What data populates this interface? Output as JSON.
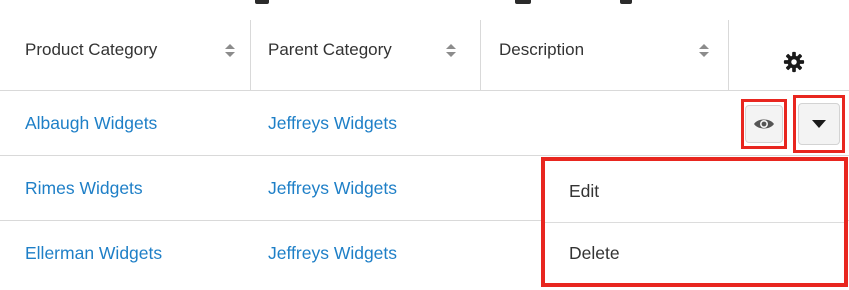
{
  "table": {
    "columns": [
      {
        "label": "Product Category"
      },
      {
        "label": "Parent Category"
      },
      {
        "label": "Description"
      }
    ],
    "rows": [
      {
        "product_category": "Albaugh Widgets",
        "parent_category": "Jeffreys Widgets",
        "description": ""
      },
      {
        "product_category": "Rimes Widgets",
        "parent_category": "Jeffreys Widgets",
        "description": ""
      },
      {
        "product_category": "Ellerman Widgets",
        "parent_category": "Jeffreys Widgets",
        "description": ""
      }
    ]
  },
  "row_actions": {
    "preview_icon": "eye-icon",
    "dropdown_icon": "caret-down-icon",
    "settings_icon": "gear-icon",
    "highlight_color": "#e8261f",
    "menu": [
      {
        "label": "Edit"
      },
      {
        "label": "Delete"
      }
    ]
  },
  "colors": {
    "link": "#1e7fc7",
    "text": "#333333",
    "border": "#d9d9d9"
  }
}
